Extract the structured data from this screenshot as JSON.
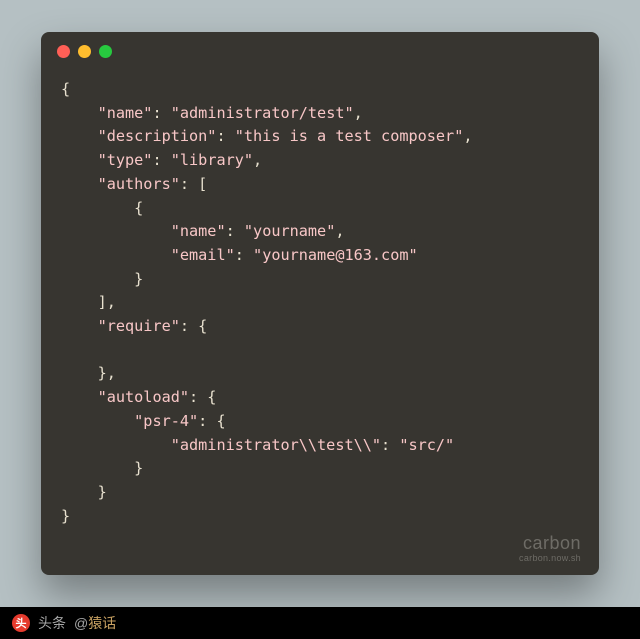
{
  "window": {
    "dots": [
      "red",
      "yellow",
      "green"
    ]
  },
  "code": {
    "l1": "{",
    "l2k": "\"name\"",
    "l2v": "\"administrator/test\"",
    "l3k": "\"description\"",
    "l3v": "\"this is a test composer\"",
    "l4k": "\"type\"",
    "l4v": "\"library\"",
    "l5k": "\"authors\"",
    "l6": "{",
    "l7k": "\"name\"",
    "l7v": "\"yourname\"",
    "l8k": "\"email\"",
    "l8v": "\"yourname@163.com\"",
    "l9": "}",
    "l10": "],",
    "l11k": "\"require\"",
    "l12": "",
    "l13": "},",
    "l14k": "\"autoload\"",
    "l15k": "\"psr-4\"",
    "l16k": "\"administrator\\\\test\\\\\"",
    "l16v": "\"src/\"",
    "l17": "}",
    "l18": "}",
    "l19": "}"
  },
  "punct": {
    "colon_comma": ": ",
    "comma": ",",
    "colon_openbracket": ": [",
    "colon_openbrace": ": {"
  },
  "watermark": {
    "big": "carbon",
    "small": "carbon.now.sh"
  },
  "footer": {
    "label": "头条",
    "at": "@",
    "handle": "猿话"
  }
}
